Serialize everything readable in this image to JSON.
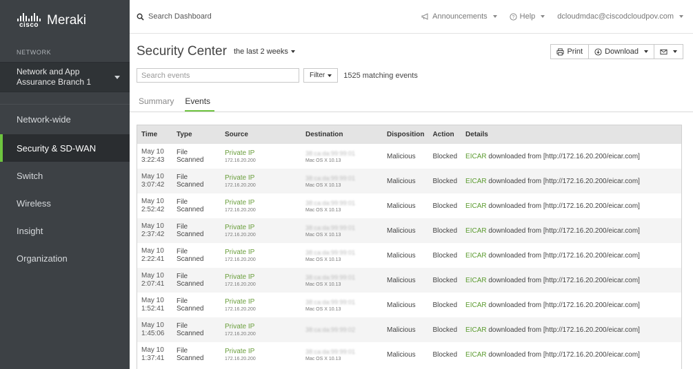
{
  "brand": {
    "cisco": "cisco",
    "product": "Meraki"
  },
  "sidebar": {
    "network_label": "NETWORK",
    "network_name_line1": "Network and App",
    "network_name_line2": "Assurance Branch 1",
    "items": [
      {
        "label": "Network-wide",
        "active": false
      },
      {
        "label": "Security & SD-WAN",
        "active": true
      },
      {
        "label": "Switch",
        "active": false
      },
      {
        "label": "Wireless",
        "active": false
      },
      {
        "label": "Insight",
        "active": false
      },
      {
        "label": "Organization",
        "active": false
      }
    ]
  },
  "topbar": {
    "search_label": "Search Dashboard",
    "announcements": "Announcements",
    "help": "Help",
    "user": "dcloudmdac@ciscodcloudpov.com"
  },
  "page": {
    "title": "Security Center",
    "time_range": "the last 2 weeks",
    "print": "Print",
    "download": "Download",
    "search_placeholder": "Search events",
    "filter": "Filter",
    "match_count": "1525 matching events",
    "tabs": [
      "Summary",
      "Events"
    ],
    "active_tab": "Events"
  },
  "table": {
    "headers": [
      "Time",
      "Type",
      "Source",
      "Destination",
      "Disposition",
      "Action",
      "Details"
    ],
    "rows": [
      {
        "date": "May 10",
        "time": "3:22:43",
        "type": "File Scanned",
        "source": "Private IP",
        "source_ip": "172.16.20.200",
        "dest": "38:ca:da:99:99:01",
        "dest_os": "Mac OS X 10.13",
        "disposition": "Malicious",
        "action": "Blocked",
        "details_link": "EICAR",
        "details_text": " downloaded from [http://172.16.20.200/eicar.com]"
      },
      {
        "date": "May 10",
        "time": "3:07:42",
        "type": "File Scanned",
        "source": "Private IP",
        "source_ip": "172.16.20.200",
        "dest": "38:ca:da:99:99:01",
        "dest_os": "Mac OS X 10.13",
        "disposition": "Malicious",
        "action": "Blocked",
        "details_link": "EICAR",
        "details_text": " downloaded from [http://172.16.20.200/eicar.com]"
      },
      {
        "date": "May 10",
        "time": "2:52:42",
        "type": "File Scanned",
        "source": "Private IP",
        "source_ip": "172.16.20.200",
        "dest": "38:ca:da:99:99:01",
        "dest_os": "Mac OS X 10.13",
        "disposition": "Malicious",
        "action": "Blocked",
        "details_link": "EICAR",
        "details_text": " downloaded from [http://172.16.20.200/eicar.com]"
      },
      {
        "date": "May 10",
        "time": "2:37:42",
        "type": "File Scanned",
        "source": "Private IP",
        "source_ip": "172.16.20.200",
        "dest": "38:ca:da:99:99:01",
        "dest_os": "Mac OS X 10.13",
        "disposition": "Malicious",
        "action": "Blocked",
        "details_link": "EICAR",
        "details_text": " downloaded from [http://172.16.20.200/eicar.com]"
      },
      {
        "date": "May 10",
        "time": "2:22:41",
        "type": "File Scanned",
        "source": "Private IP",
        "source_ip": "172.16.20.200",
        "dest": "38:ca:da:99:99:01",
        "dest_os": "Mac OS X 10.13",
        "disposition": "Malicious",
        "action": "Blocked",
        "details_link": "EICAR",
        "details_text": " downloaded from [http://172.16.20.200/eicar.com]"
      },
      {
        "date": "May 10",
        "time": "2:07:41",
        "type": "File Scanned",
        "source": "Private IP",
        "source_ip": "172.16.20.200",
        "dest": "38:ca:da:99:99:01",
        "dest_os": "Mac OS X 10.13",
        "disposition": "Malicious",
        "action": "Blocked",
        "details_link": "EICAR",
        "details_text": " downloaded from [http://172.16.20.200/eicar.com]"
      },
      {
        "date": "May 10",
        "time": "1:52:41",
        "type": "File Scanned",
        "source": "Private IP",
        "source_ip": "172.16.20.200",
        "dest": "38:ca:da:99:99:01",
        "dest_os": "Mac OS X 10.13",
        "disposition": "Malicious",
        "action": "Blocked",
        "details_link": "EICAR",
        "details_text": " downloaded from [http://172.16.20.200/eicar.com]"
      },
      {
        "date": "May 10",
        "time": "1:45:06",
        "type": "File Scanned",
        "source": "Private IP",
        "source_ip": "172.16.20.200",
        "dest": "38:ca:da:99:99:02",
        "dest_os": "",
        "disposition": "Malicious",
        "action": "Blocked",
        "details_link": "EICAR",
        "details_text": " downloaded from [http://172.16.20.200/eicar.com]"
      },
      {
        "date": "May 10",
        "time": "1:37:41",
        "type": "File Scanned",
        "source": "Private IP",
        "source_ip": "172.16.20.200",
        "dest": "38:ca:da:99:99:01",
        "dest_os": "Mac OS X 10.13",
        "disposition": "Malicious",
        "action": "Blocked",
        "details_link": "EICAR",
        "details_text": " downloaded from [http://172.16.20.200/eicar.com]"
      }
    ]
  },
  "colors": {
    "sidebar_bg": "#3d4145",
    "accent_green": "#6ec43f",
    "link_green": "#5a9a2e"
  },
  "icons": [
    "cisco-logo",
    "search-icon",
    "megaphone-icon",
    "help-icon",
    "print-icon",
    "download-icon",
    "mail-icon"
  ]
}
